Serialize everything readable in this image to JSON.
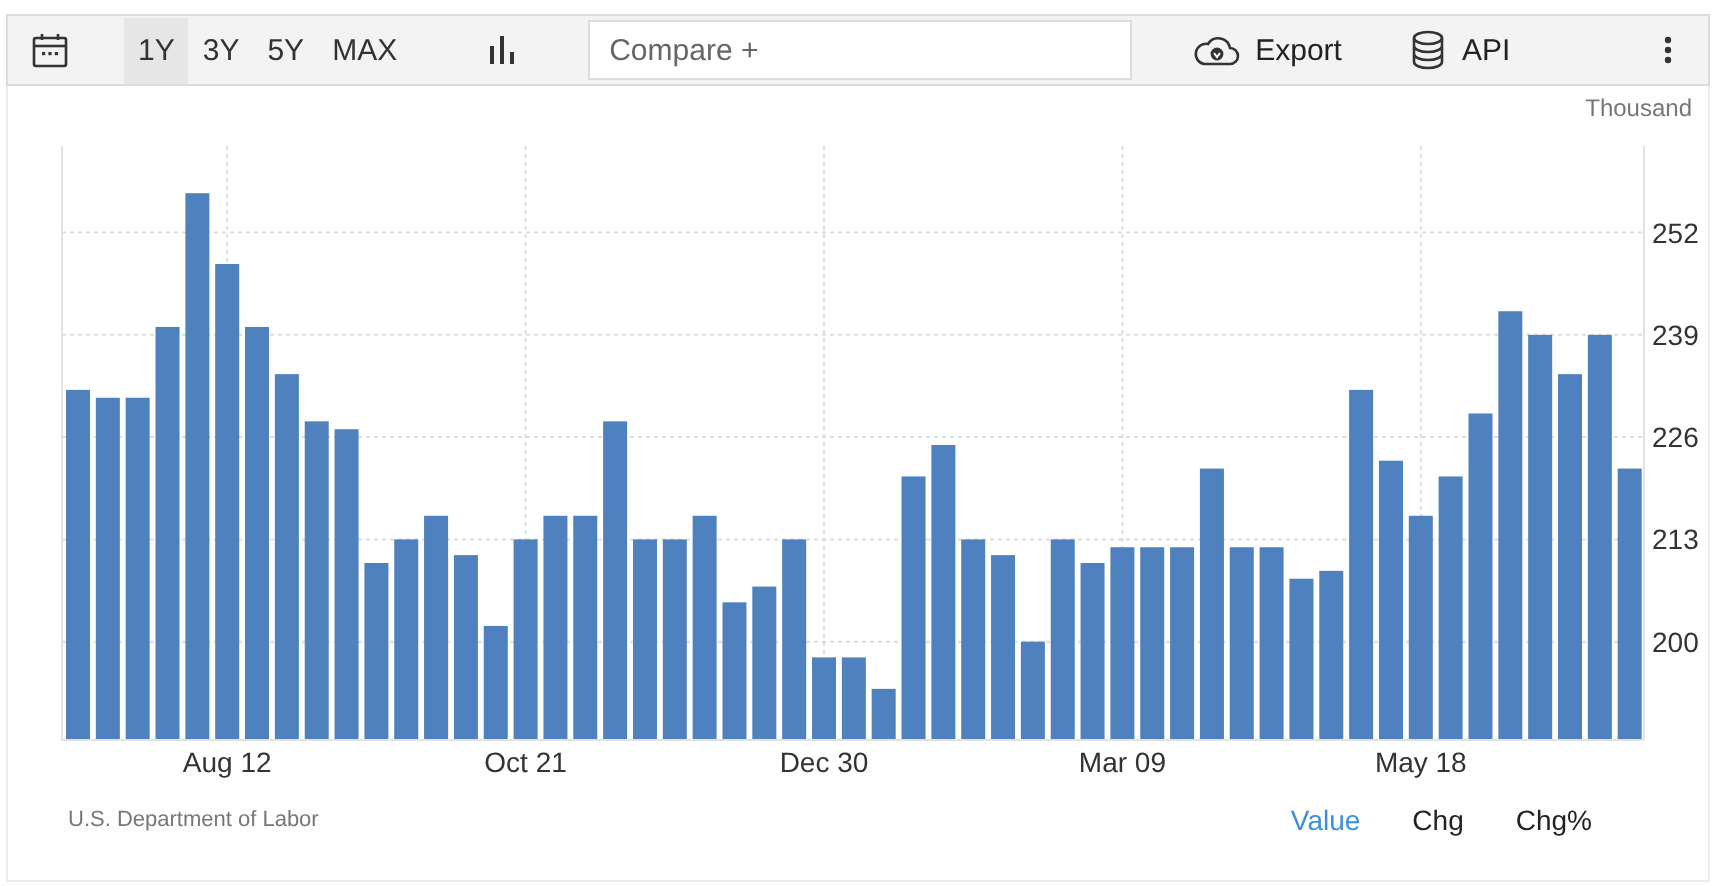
{
  "toolbar": {
    "ranges": [
      {
        "label": "1Y",
        "selected": true
      },
      {
        "label": "3Y",
        "selected": false
      },
      {
        "label": "5Y",
        "selected": false
      },
      {
        "label": "MAX",
        "selected": false
      }
    ],
    "compare": {
      "placeholder": "Compare +"
    },
    "export": "Export",
    "api": "API"
  },
  "chart": {
    "unit": "Thousand",
    "chart_data": {
      "type": "bar",
      "values": [
        232,
        231,
        231,
        240,
        257,
        248,
        240,
        234,
        228,
        227,
        210,
        213,
        216,
        211,
        202,
        213,
        216,
        216,
        228,
        213,
        213,
        216,
        205,
        207,
        213,
        198,
        198,
        194,
        221,
        225,
        213,
        211,
        200,
        213,
        210,
        212,
        212,
        212,
        222,
        212,
        212,
        208,
        209,
        232,
        223,
        216,
        221,
        229,
        242,
        239,
        234,
        239,
        222
      ],
      "categories": [
        null,
        null,
        null,
        null,
        null,
        "Aug 12",
        null,
        null,
        null,
        null,
        null,
        null,
        null,
        null,
        null,
        "Oct 21",
        null,
        null,
        null,
        null,
        null,
        null,
        null,
        null,
        null,
        "Dec 30",
        null,
        null,
        null,
        null,
        null,
        null,
        null,
        null,
        null,
        "Mar 09",
        null,
        null,
        null,
        null,
        null,
        null,
        null,
        null,
        null,
        "May 18",
        null,
        null,
        null,
        null,
        null,
        null,
        null
      ],
      "grid": true,
      "ylim": [
        187.5,
        263
      ],
      "yticks": [
        200,
        213,
        226,
        239,
        252
      ]
    }
  },
  "footer": {
    "source": "U.S. Department of Labor",
    "modes": [
      {
        "label": "Value",
        "selected": true
      },
      {
        "label": "Chg",
        "selected": false
      },
      {
        "label": "Chg%",
        "selected": false
      }
    ]
  }
}
